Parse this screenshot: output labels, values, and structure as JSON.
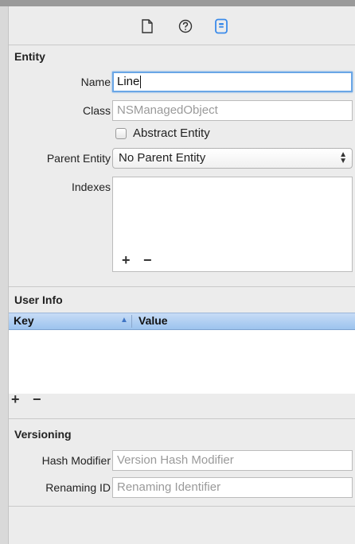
{
  "inspector_tabs": [
    {
      "icon": "file-icon"
    },
    {
      "icon": "help-icon"
    },
    {
      "icon": "data-model-inspector-icon",
      "active": true
    }
  ],
  "entity": {
    "section_title": "Entity",
    "name_label": "Name",
    "name_value": "Line",
    "class_label": "Class",
    "class_placeholder": "NSManagedObject",
    "abstract_label": "Abstract Entity",
    "abstract_checked": false,
    "parent_label": "Parent Entity",
    "parent_value": "No Parent Entity",
    "indexes_label": "Indexes",
    "add_symbol": "+",
    "remove_symbol": "−"
  },
  "user_info": {
    "section_title": "User Info",
    "columns": [
      "Key",
      "Value"
    ],
    "sort_indicator": "▲",
    "rows": [],
    "add_symbol": "+",
    "remove_symbol": "−"
  },
  "versioning": {
    "section_title": "Versioning",
    "hash_label": "Hash Modifier",
    "hash_placeholder": "Version Hash Modifier",
    "renaming_label": "Renaming ID",
    "renaming_placeholder": "Renaming Identifier"
  },
  "colors": {
    "accent": "#3b8bea",
    "header_blue": "#9cc3ee",
    "focus_ring": "#6aa6e6"
  }
}
